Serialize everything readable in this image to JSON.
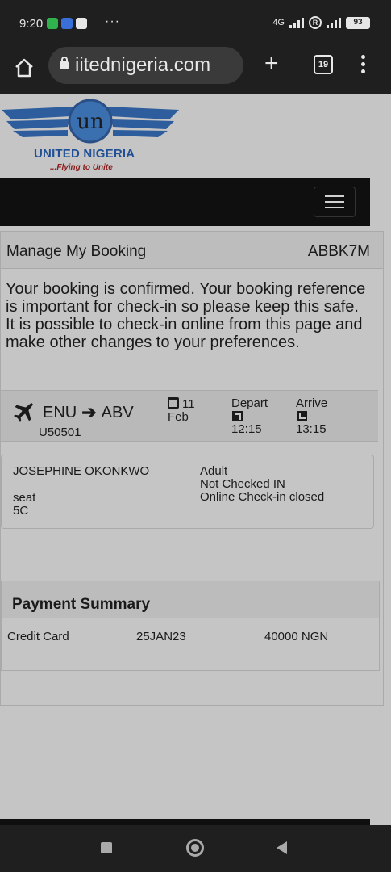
{
  "status_bar": {
    "time": "9:20",
    "more": "···",
    "network": "4G",
    "battery": "93"
  },
  "browser": {
    "url": "iitednigeria.com",
    "tab_count": "19"
  },
  "site": {
    "logo_monogram": "un",
    "logo_name": "UNITED NIGERIA",
    "logo_tagline": "...Flying to Unite"
  },
  "booking": {
    "title": "Manage My Booking",
    "reference": "ABBK7M",
    "confirmation": "Your booking is confirmed. Your booking reference is important for check-in so please keep this safe. It is possible to check-in online from this page and make other changes to your preferences."
  },
  "flight": {
    "from": "ENU",
    "to": "ABV",
    "flight_number": "U50501",
    "day": "11",
    "month": "Feb",
    "depart_label": "Depart",
    "depart_time": "12:15",
    "arrive_label": "Arrive",
    "arrive_time": "13:15"
  },
  "passenger": {
    "name": "JOSEPHINE OKONKWO",
    "seat_label": "seat",
    "seat": "5C",
    "type": "Adult",
    "checkin_status": "Not Checked IN",
    "online_checkin": "Online Check-in closed"
  },
  "payment": {
    "title": "Payment Summary",
    "method": "Credit Card",
    "date": "25JAN23",
    "amount": "40000 NGN"
  }
}
